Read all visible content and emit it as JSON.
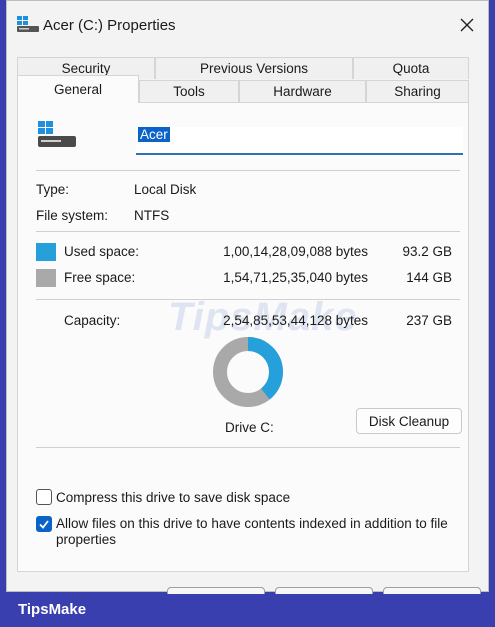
{
  "window": {
    "title": "Acer (C:) Properties"
  },
  "tabs": {
    "row1": [
      "Security",
      "Previous Versions",
      "Quota"
    ],
    "row2": [
      "General",
      "Tools",
      "Hardware",
      "Sharing"
    ],
    "active": "General"
  },
  "general": {
    "drive_name": "Acer",
    "type_label": "Type:",
    "type_value": "Local Disk",
    "fs_label": "File system:",
    "fs_value": "NTFS",
    "used_label": "Used space:",
    "used_bytes": "1,00,14,28,09,088 bytes",
    "used_gb": "93.2 GB",
    "free_label": "Free space:",
    "free_bytes": "1,54,71,25,35,040 bytes",
    "free_gb": "144 GB",
    "capacity_label": "Capacity:",
    "capacity_bytes": "2,54,85,53,44,128 bytes",
    "capacity_gb": "237 GB",
    "drive_label": "Drive C:",
    "disk_cleanup": "Disk Cleanup",
    "used_fraction": 0.393,
    "compress_label": "Compress this drive to save disk space",
    "compress_checked": false,
    "index_label": "Allow files on this drive to have contents indexed in addition to file properties",
    "index_checked": true
  },
  "colors": {
    "used": "#26a0da",
    "free": "#a9a9a9",
    "accent": "#0b63c8"
  },
  "watermark": "TipsMake",
  "footer": {
    "brand": "TipsMake"
  }
}
